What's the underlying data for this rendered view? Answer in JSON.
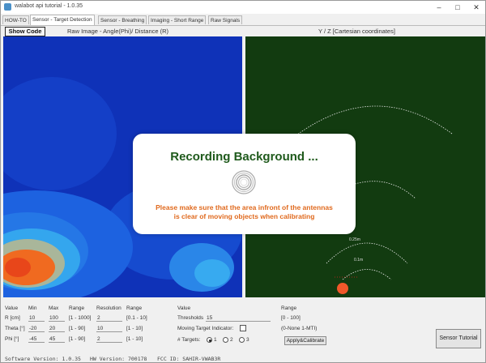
{
  "window": {
    "title": "walabot api tutorial - 1.0.35"
  },
  "tabs": [
    {
      "label": "HOW-TO"
    },
    {
      "label": "Sensor - Target Detection"
    },
    {
      "label": "Sensor - Breathing"
    },
    {
      "label": "Imaging - Short Range"
    },
    {
      "label": "Raw Signals"
    }
  ],
  "toolbar": {
    "show_code_label": "Show Code",
    "left_title": "Raw Image - Angle(Phi)/ Distance (R)",
    "right_title": "Y / Z [Cartesian coordinates]"
  },
  "modal": {
    "title": "Recording Background ...",
    "message_line1": "Please make sure that the area infront of the antennas",
    "message_line2": "is clear of moving objects when calibrating"
  },
  "controls": {
    "headers": {
      "value": "Value",
      "min": "Min",
      "max": "Max",
      "range": "Range",
      "resolution": "Resolution",
      "res_range": "Range",
      "value2": "Value",
      "range2": "Range"
    },
    "rows": [
      {
        "label": "R [cm]",
        "min": "10",
        "max": "100",
        "range": "[1 - 1000]",
        "resolution": "2",
        "res_range": "[0.1 - 10]"
      },
      {
        "label": "Theta [°]",
        "min": "-20",
        "max": "20",
        "range": "[1 - 90]",
        "resolution": "10",
        "res_range": "[1 - 10]"
      },
      {
        "label": "Phi [°]",
        "min": "-45",
        "max": "45",
        "range": "[1 - 90]",
        "resolution": "2",
        "res_range": "[1 - 10]"
      }
    ],
    "threshold_label": "Thresholds",
    "threshold_value": "15",
    "threshold_range": "[0 - 100]",
    "mti_label": "Moving Target Indicator:",
    "mti_range": "(0-None 1-MTI)",
    "targets_label": "# Targets:",
    "target_options": [
      "1",
      "2",
      "3"
    ],
    "apply_button": "Apply&Calibrate",
    "tutorial_button": "Sensor Tutorial"
  },
  "statusbar": {
    "software": "Software Version: 1.0.35",
    "hw": "HW Version: 700178",
    "fcc": "FCC ID: SAHIR-VWAB3R"
  },
  "plot_right": {
    "arc_labels": [
      "",
      "",
      "0.25m",
      "0.1m"
    ],
    "target_marker_color": "#f0582a"
  },
  "colors": {
    "heatmap_background": "#0f32b8",
    "cartesian_background": "#123b10",
    "modal_title": "#1f5a1c",
    "modal_message": "#e0691d"
  }
}
